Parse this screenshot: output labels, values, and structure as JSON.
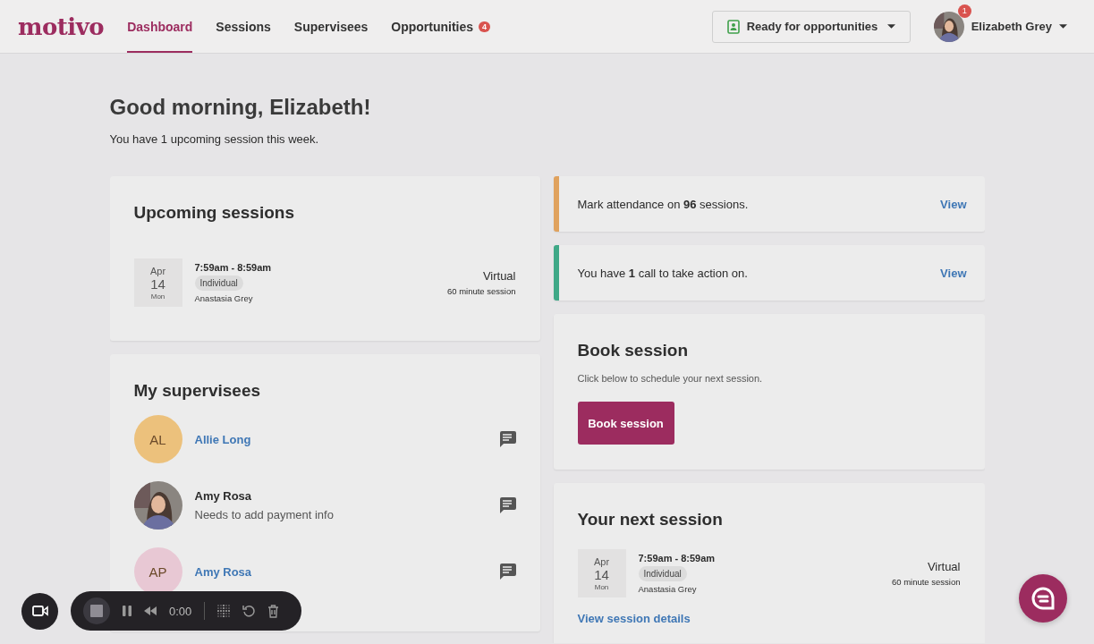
{
  "header": {
    "logo": "motivo",
    "nav": [
      {
        "label": "Dashboard",
        "selected": true
      },
      {
        "label": "Sessions",
        "selected": false
      },
      {
        "label": "Supervisees",
        "selected": false
      },
      {
        "label": "Opportunities",
        "selected": false,
        "badge": "4"
      }
    ],
    "status_dropdown": "Ready for opportunities",
    "user": {
      "name": "Elizabeth Grey",
      "badge": "1"
    }
  },
  "greeting": {
    "title": "Good morning, Elizabeth!",
    "subtitle": "You have 1 upcoming session this week."
  },
  "upcoming_sessions": {
    "title": "Upcoming sessions",
    "session": {
      "month": "Apr",
      "day": "14",
      "weekday": "Mon",
      "time": "7:59am - 8:59am",
      "type": "Individual",
      "person": "Anastasia Grey",
      "location": "Virtual",
      "duration": "60 minute session"
    }
  },
  "supervisees": {
    "title": "My supervisees",
    "items": [
      {
        "initials": "AL",
        "name": "Allie Long",
        "kind": "initials",
        "link": true,
        "color": "#ecc17c"
      },
      {
        "name": "Amy Rosa",
        "kind": "photo",
        "link": false,
        "note": "Needs to add payment info"
      },
      {
        "initials": "AP",
        "name": "Amy Rosa",
        "kind": "initials",
        "link": true,
        "color": "#e8c8d4"
      }
    ]
  },
  "alerts": [
    {
      "text": "Mark attendance on **96** sessions.",
      "action": "View",
      "color": "#e0a25e"
    },
    {
      "text": "You have **1** call to take action on.",
      "action": "View",
      "color": "#3fa887"
    }
  ],
  "book_session": {
    "title": "Book session",
    "text": "Click below to schedule your next session.",
    "button": "Book session"
  },
  "next_session": {
    "title": "Your next session",
    "session": {
      "month": "Apr",
      "day": "14",
      "weekday": "Mon",
      "time": "7:59am - 8:59am",
      "type": "Individual",
      "person": "Anastasia Grey",
      "location": "Virtual",
      "duration": "60 minute session"
    },
    "link": "View session details"
  },
  "recorder": {
    "time": "0:00"
  }
}
